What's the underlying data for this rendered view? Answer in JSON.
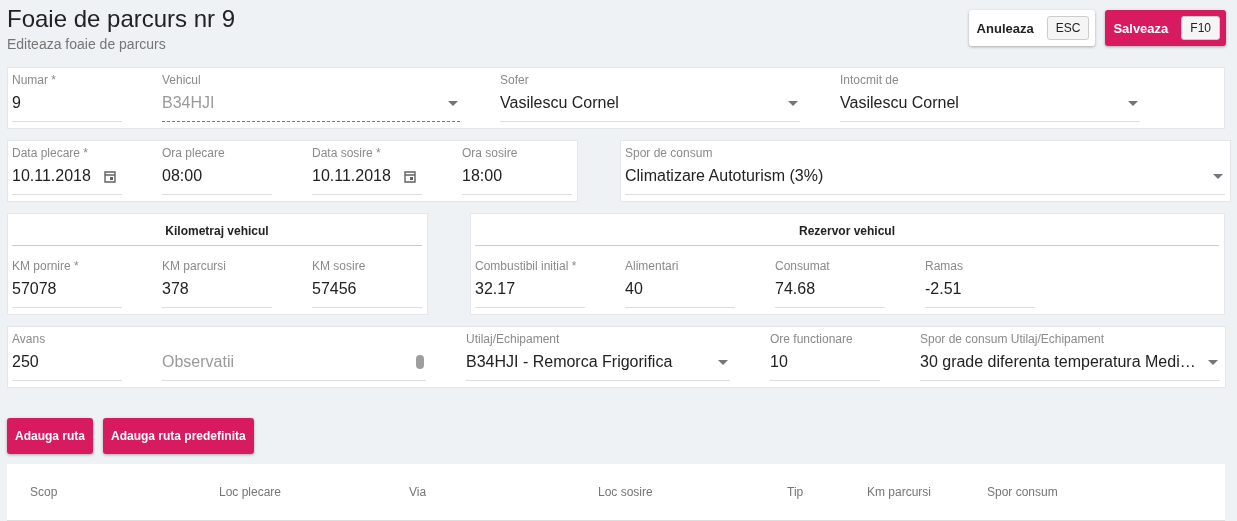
{
  "header": {
    "title": "Foaie de parcurs nr 9",
    "subtitle": "Editeaza foaie de parcurs"
  },
  "actions": [
    {
      "label": "Anuleaza",
      "shortcut": "ESC",
      "kind": "secondary"
    },
    {
      "label": "Salveaza",
      "shortcut": "F10",
      "kind": "primary"
    }
  ],
  "form_rows": [
    {
      "cards": [
        {
          "fields": [
            {
              "label": "Numar *",
              "value": "9",
              "kind": "text",
              "disabled": false
            },
            {
              "label": "Vehicul",
              "value": "B34HJI",
              "kind": "select",
              "disabled": true
            },
            {
              "label": "Sofer",
              "value": "Vasilescu Cornel",
              "kind": "select",
              "disabled": false
            },
            {
              "label": "Intocmit de",
              "value": "Vasilescu Cornel",
              "kind": "select",
              "disabled": false
            }
          ]
        }
      ]
    },
    {
      "cards": [
        {
          "fields": [
            {
              "label": "Data plecare *",
              "value": "10.11.2018",
              "kind": "date",
              "disabled": false
            },
            {
              "label": "Ora plecare",
              "value": "08:00",
              "kind": "text",
              "disabled": false
            },
            {
              "label": "Data sosire *",
              "value": "10.11.2018",
              "kind": "date",
              "disabled": false
            },
            {
              "label": "Ora sosire",
              "value": "18:00",
              "kind": "text",
              "disabled": false
            }
          ]
        },
        {
          "fields": [
            {
              "label": "Spor de consum",
              "value": "Climatizare Autoturism (3%)",
              "kind": "select",
              "disabled": false
            }
          ]
        }
      ]
    },
    {
      "cards": [
        {
          "title": "Kilometraj vehicul",
          "fields": [
            {
              "label": "KM pornire *",
              "value": "57078",
              "kind": "text",
              "disabled": false
            },
            {
              "label": "KM parcursi",
              "value": "378",
              "kind": "text",
              "disabled": false
            },
            {
              "label": "KM sosire",
              "value": "57456",
              "kind": "text",
              "disabled": false
            }
          ]
        },
        {
          "title": "Rezervor vehicul",
          "fields": [
            {
              "label": "Combustibil initial *",
              "value": "32.17",
              "kind": "text",
              "disabled": false
            },
            {
              "label": "Alimentari",
              "value": "40",
              "kind": "text",
              "disabled": false
            },
            {
              "label": "Consumat",
              "value": "74.68",
              "kind": "text",
              "disabled": false
            },
            {
              "label": "Ramas",
              "value": "-2.51",
              "kind": "text",
              "disabled": false
            }
          ]
        }
      ]
    },
    {
      "cards": [
        {
          "fields": [
            {
              "label": "Avans",
              "value": "250",
              "kind": "text",
              "disabled": false
            },
            {
              "placeholder": "Observatii",
              "kind": "textarea",
              "disabled": false
            },
            {
              "label": "Utilaj/Echipament",
              "value": "B34HJI - Remorca Frigorifica",
              "kind": "select",
              "disabled": false
            },
            {
              "label": "Ore functionare",
              "value": "10",
              "kind": "text",
              "disabled": false
            },
            {
              "label": "Spor de consum Utilaj/Echipament",
              "value": "30 grade diferenta temperatura Medi…",
              "kind": "select",
              "disabled": false
            }
          ]
        }
      ]
    }
  ],
  "route_buttons": [
    "Adauga ruta",
    "Adauga ruta predefinita"
  ],
  "routes_table": {
    "columns": [
      "Scop",
      "Loc plecare",
      "Via",
      "Loc sosire",
      "Tip",
      "Km parcursi",
      "Spor consum"
    ]
  }
}
